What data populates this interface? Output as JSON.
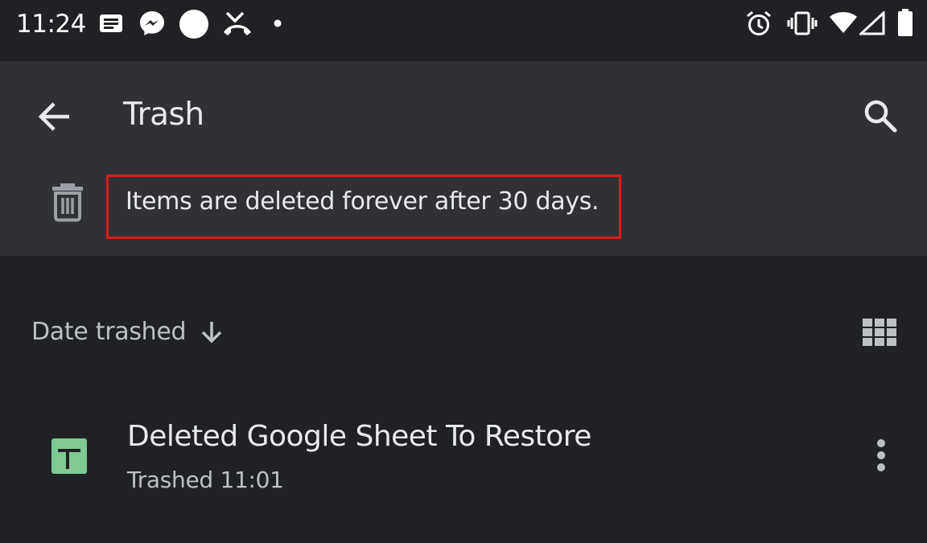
{
  "status_bar": {
    "time": "11:24",
    "icons": [
      "message-icon",
      "messenger-icon",
      "circle-icon",
      "missed-call-icon",
      "dot-icon",
      "alarm-icon",
      "vibrate-icon",
      "wifi-icon",
      "signal-icon",
      "battery-icon"
    ]
  },
  "app_bar": {
    "title": "Trash",
    "back_icon": "arrow-back-icon",
    "search_icon": "search-icon"
  },
  "notice": {
    "icon": "trash-icon",
    "text": "Items are deleted forever after 30 days.",
    "highlight_color": "#e01b1b"
  },
  "sort": {
    "label": "Date trashed",
    "direction_icon": "arrow-down-icon",
    "view_icon": "grid-view-icon"
  },
  "files": [
    {
      "name": "Deleted Google Sheet To Restore",
      "subtitle": "Trashed 11:01",
      "icon": "sheets-icon",
      "icon_color": "#81c995"
    }
  ],
  "colors": {
    "background": "#202124",
    "app_bar": "#303134",
    "text_primary": "#e8eaed",
    "text_secondary": "#bdc1c6"
  }
}
